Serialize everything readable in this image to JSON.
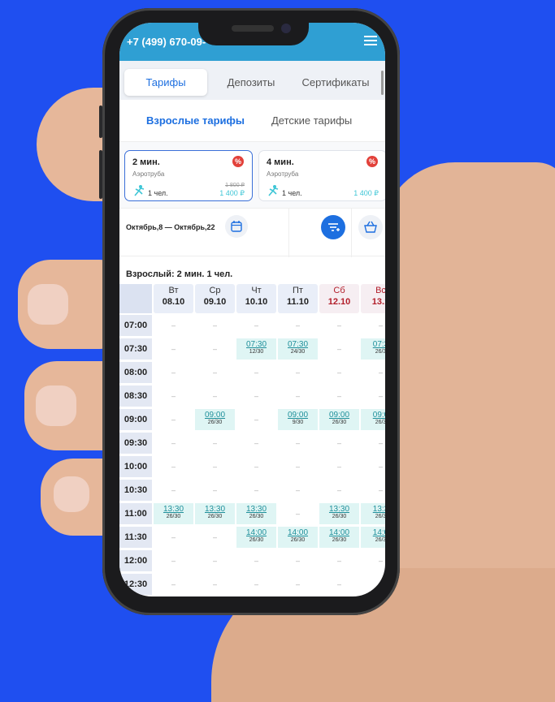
{
  "header": {
    "phone": "+7 (499) 670-09-"
  },
  "tabs": [
    {
      "label": "Тарифы",
      "active": true
    },
    {
      "label": "Депозиты",
      "active": false
    },
    {
      "label": "Сертификаты",
      "active": false
    }
  ],
  "subtabs": [
    {
      "label": "Взрослые тарифы",
      "active": true
    },
    {
      "label": "Детские тарифы",
      "active": false
    }
  ],
  "cards": [
    {
      "title": "2 мин.",
      "subtitle": "Аэротруба",
      "badge": "%",
      "persons": "1 чел.",
      "old_price": "1 800 ₽",
      "price": "1 400 ₽",
      "active": true
    },
    {
      "title": "4 мин.",
      "subtitle": "Аэротруба",
      "badge": "%",
      "persons": "1 чел.",
      "old_price": "",
      "price": "1 400 ₽",
      "active": false
    }
  ],
  "filters": {
    "date_range": "Октябрь,8 — Октябрь,22"
  },
  "schedule": {
    "title": "Взрослый: 2 мин. 1 чел.",
    "days": [
      {
        "name": "Вт",
        "date": "08.10",
        "weekend": false
      },
      {
        "name": "Ср",
        "date": "09.10",
        "weekend": false
      },
      {
        "name": "Чт",
        "date": "10.10",
        "weekend": false
      },
      {
        "name": "Пт",
        "date": "11.10",
        "weekend": false
      },
      {
        "name": "Сб",
        "date": "12.10",
        "weekend": true
      },
      {
        "name": "Вс",
        "date": "13.1",
        "weekend": true
      }
    ],
    "times": [
      "07:00",
      "07:30",
      "08:00",
      "08:30",
      "09:00",
      "09:30",
      "10:00",
      "10:30",
      "11:00",
      "11:30",
      "12:00",
      "12:30"
    ],
    "empty_mark": "–",
    "slots": [
      [
        "",
        "",
        "",
        "",
        "",
        ""
      ],
      [
        "",
        "",
        "07:30|12/30",
        "07:30|24/30",
        "",
        "07:3|26/3"
      ],
      [
        "",
        "",
        "",
        "",
        "",
        ""
      ],
      [
        "",
        "",
        "",
        "",
        "",
        ""
      ],
      [
        "",
        "09:00|26/30",
        "",
        "09:00|9/30",
        "09:00|26/30",
        "09:0|26/3"
      ],
      [
        "",
        "",
        "",
        "",
        "",
        ""
      ],
      [
        "",
        "",
        "",
        "",
        "",
        ""
      ],
      [
        "",
        "",
        "",
        "",
        "",
        ""
      ],
      [
        "13:30|26/30",
        "13:30|26/30",
        "13:30|26/30",
        "",
        "13:30|26/30",
        "13:3|26/3"
      ],
      [
        "",
        "",
        "14:00|26/30",
        "14:00|26/30",
        "14:00|26/30",
        "14:0|26/3"
      ],
      [
        "",
        "",
        "",
        "",
        "",
        ""
      ],
      [
        "",
        "",
        "",
        "",
        "",
        ""
      ]
    ]
  }
}
